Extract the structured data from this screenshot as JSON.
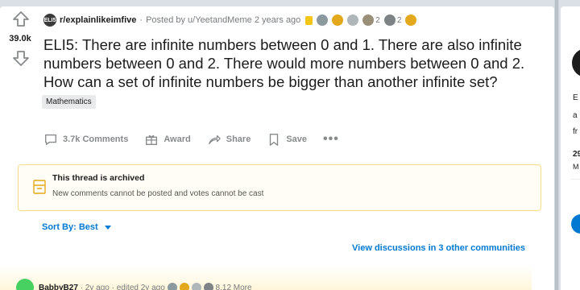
{
  "post": {
    "vote_count": "39.0k",
    "subreddit": "r/explainlikeimfive",
    "subreddit_avatar": "ELI5",
    "posted_by": "Posted by u/YeetandMeme",
    "posted_time": "2 years ago",
    "awards": [
      {
        "name": "gold-rect",
        "color": "#f5c518"
      },
      {
        "name": "wholesome-award",
        "color": "#8a9a9e",
        "count": ""
      },
      {
        "name": "gold-award",
        "color": "#e3a81b",
        "count": ""
      },
      {
        "name": "helpful-award",
        "color": "#b0b7bb",
        "count": ""
      },
      {
        "name": "trophy-award",
        "color": "#9a9078",
        "count": "2"
      },
      {
        "name": "silver-award",
        "color": "#7e8386",
        "count": "2"
      },
      {
        "name": "take-my-energy-award",
        "color": "#e3a81b",
        "count": ""
      }
    ],
    "title": "ELI5: There are infinite numbers between 0 and 1. There are also infinite numbers between 0 and 2. There would more numbers between 0 and 2. How can a set of infinite numbers be bigger than another infinite set?",
    "flair": "Mathematics",
    "actions": {
      "comments": "3.7k Comments",
      "award": "Award",
      "share": "Share",
      "save": "Save",
      "more": "•••"
    }
  },
  "archive": {
    "title": "This thread is archived",
    "message": "New comments cannot be posted and votes cannot be cast"
  },
  "sort": {
    "label": "Sort By: Best"
  },
  "discussions_link": "View discussions in 3 other communities",
  "comment": {
    "user": "BabbyB27",
    "meta": "· 2y ago · edited 2y ago",
    "more": "8.12 More"
  },
  "sidebar": {
    "line1": "E",
    "line2": "a",
    "line3": "fr",
    "stat": "29",
    "stat_label": "M"
  },
  "colors": {
    "accent": "#0079d3",
    "background": "#dae0e6",
    "archive_border": "#f5dd8a"
  }
}
